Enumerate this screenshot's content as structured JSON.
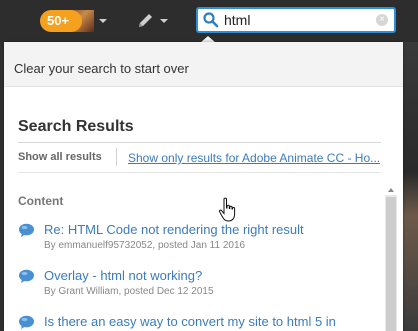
{
  "topbar": {
    "notifications_badge": "50+",
    "search": {
      "value": "html",
      "clear_icon": "clear-icon"
    }
  },
  "panel": {
    "clear_hint": "Clear your search to start over",
    "results_title": "Search Results",
    "filters": {
      "all": "Show all results",
      "product": "Show only results for Adobe Animate CC - Ho..."
    },
    "content_heading": "Content",
    "results": [
      {
        "title": "Re: HTML Code not rendering the right result",
        "meta": "By emmanuelf95732052, posted Jan 11 2016"
      },
      {
        "title": "Overlay - html not working?",
        "meta": "By Grant William, posted Dec 12 2015"
      },
      {
        "title": "Is there an easy way to convert my site to html 5 in",
        "meta": ""
      }
    ]
  },
  "colors": {
    "accent_link": "#3b7bbf",
    "badge": "#f4a11f",
    "search_border": "#2e8fd6"
  }
}
